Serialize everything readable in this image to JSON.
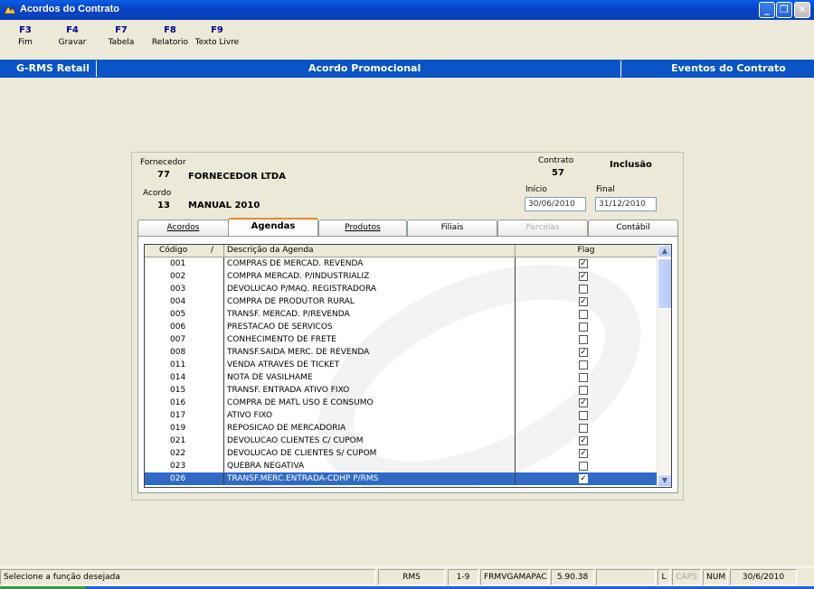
{
  "window": {
    "title": "Acordos do Contrato"
  },
  "fkeys": [
    {
      "key": "F3",
      "label": "Fim"
    },
    {
      "key": "F4",
      "label": "Gravar"
    },
    {
      "key": "F7",
      "label": "Tabela"
    },
    {
      "key": "F8",
      "label": "Relatorio"
    },
    {
      "key": "F9",
      "label": "Texto Livre"
    }
  ],
  "band": {
    "left": "G-RMS Retail",
    "center": "Acordo Promocional",
    "right": "Eventos do Contrato"
  },
  "header": {
    "fornecedor_label": "Fornecedor",
    "fornecedor_code": "77",
    "fornecedor_name": "FORNECEDOR LTDA",
    "acordo_label": "Acordo",
    "acordo_code": "13",
    "acordo_name": "MANUAL 2010",
    "contrato_label": "Contrato",
    "contrato_value": "57",
    "mode": "Inclusão",
    "inicio_label": "Início",
    "inicio_value": "30/06/2010",
    "final_label": "Final",
    "final_value": "31/12/2010"
  },
  "tabs": [
    {
      "label": "Acordos",
      "state": "normal"
    },
    {
      "label": "Agendas",
      "state": "active"
    },
    {
      "label": "Produtos",
      "state": "normal"
    },
    {
      "label": "Filiais",
      "state": "normal"
    },
    {
      "label": "Parcelas",
      "state": "disabled"
    },
    {
      "label": "Contábil",
      "state": "normal"
    }
  ],
  "grid": {
    "columns": [
      "Código",
      "/",
      "Descrição da Agenda",
      "Flag"
    ],
    "rows": [
      {
        "code": "001",
        "desc": "COMPRAS DE MERCAD. REVENDA",
        "flag": true
      },
      {
        "code": "002",
        "desc": "COMPRA MERCAD. P/INDUSTRIALIZ",
        "flag": true
      },
      {
        "code": "003",
        "desc": "DEVOLUCAO P/MAQ. REGISTRADORA",
        "flag": false
      },
      {
        "code": "004",
        "desc": "COMPRA DE PRODUTOR RURAL",
        "flag": true
      },
      {
        "code": "005",
        "desc": "TRANSF. MERCAD. P/REVENDA",
        "flag": false
      },
      {
        "code": "006",
        "desc": "PRESTACAO DE SERVICOS",
        "flag": false
      },
      {
        "code": "007",
        "desc": "CONHECIMENTO DE FRETE",
        "flag": false
      },
      {
        "code": "008",
        "desc": "TRANSF.SAIDA MERC. DE REVENDA",
        "flag": true
      },
      {
        "code": "011",
        "desc": "VENDA ATRAVES DE TICKET",
        "flag": false
      },
      {
        "code": "014",
        "desc": "NOTA DE VASILHAME",
        "flag": false
      },
      {
        "code": "015",
        "desc": "TRANSF. ENTRADA ATIVO FIXO",
        "flag": false
      },
      {
        "code": "016",
        "desc": "COMPRA DE MATL USO E CONSUMO",
        "flag": true
      },
      {
        "code": "017",
        "desc": "ATIVO FIXO",
        "flag": false
      },
      {
        "code": "019",
        "desc": "REPOSICAO DE MERCADORIA",
        "flag": false
      },
      {
        "code": "021",
        "desc": "DEVOLUCAO CLIENTES C/ CUPOM",
        "flag": true
      },
      {
        "code": "022",
        "desc": "DEVOLUCAO DE CLIENTES S/ CUPOM",
        "flag": true
      },
      {
        "code": "023",
        "desc": "QUEBRA NEGATIVA",
        "flag": false
      },
      {
        "code": "026",
        "desc": "TRANSF.MERC.ENTRADA-CDHP P/RMS",
        "flag": true,
        "selected": true
      }
    ]
  },
  "statusbar": {
    "message": "Selecione a função desejada",
    "system": "RMS",
    "pages": "1-9",
    "form": "FRMVGAMAPAC",
    "version": "5.90.38",
    "blank": "",
    "l": "L",
    "caps": "CAPS",
    "num": "NUM",
    "date": "30/6/2010"
  },
  "icons": {
    "app": "rms-app-icon",
    "minimize": "minimize-icon",
    "maximize": "maximize-icon",
    "close": "close-icon"
  }
}
